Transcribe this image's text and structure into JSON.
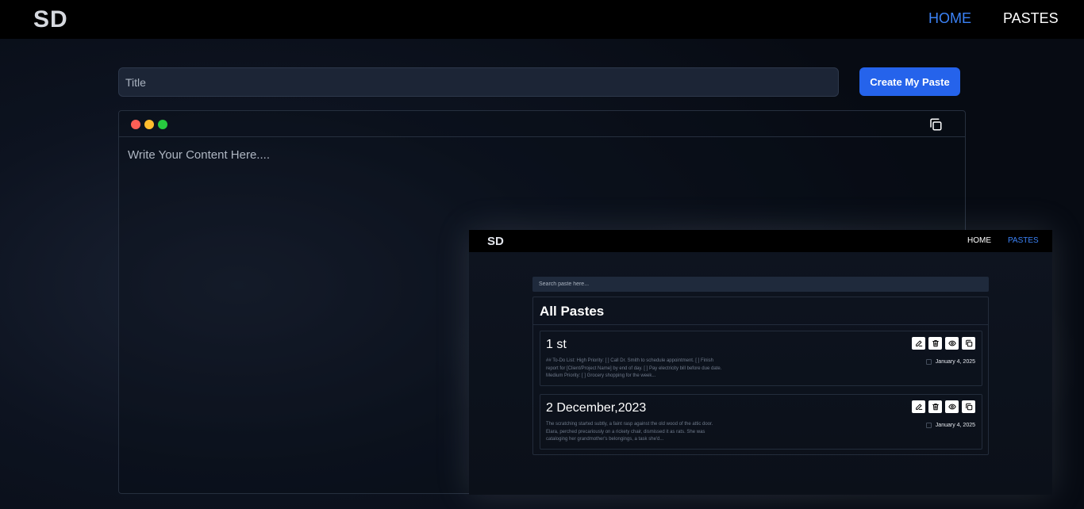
{
  "header": {
    "logo": "SD",
    "nav": {
      "home": "HOME",
      "pastes": "PASTES"
    }
  },
  "form": {
    "title_placeholder": "Title",
    "create_button": "Create My Paste"
  },
  "editor": {
    "placeholder": "Write Your Content Here...."
  },
  "preview": {
    "logo": "SD",
    "nav": {
      "home": "HOME",
      "pastes": "PASTES"
    },
    "search_placeholder": "Search paste here...",
    "panel_title": "All Pastes",
    "pastes": [
      {
        "title": "1 st",
        "body": "## To-Do List: High Priority: [ ] Call Dr. Smith to schedule appointment. [ ] Finish report for [Client/Project Name] by end of day. [ ] Pay electricity bill before due date. Medium Priority: [ ] Grocery shopping for the week...",
        "date": "January 4, 2025"
      },
      {
        "title": "2 December,2023",
        "body": "The scratching started subtly, a faint rasp against the old wood of the attic door. Elara, perched precariously on a rickety chair, dismissed it as rats. She was cataloging her grandmother's belongings, a task she'd...",
        "date": "January 4, 2025"
      }
    ]
  },
  "colors": {
    "accent": "#3b82f6",
    "button": "#2563eb",
    "dot_red": "#ff5f56",
    "dot_yellow": "#ffbd2e",
    "dot_green": "#27c93f"
  }
}
